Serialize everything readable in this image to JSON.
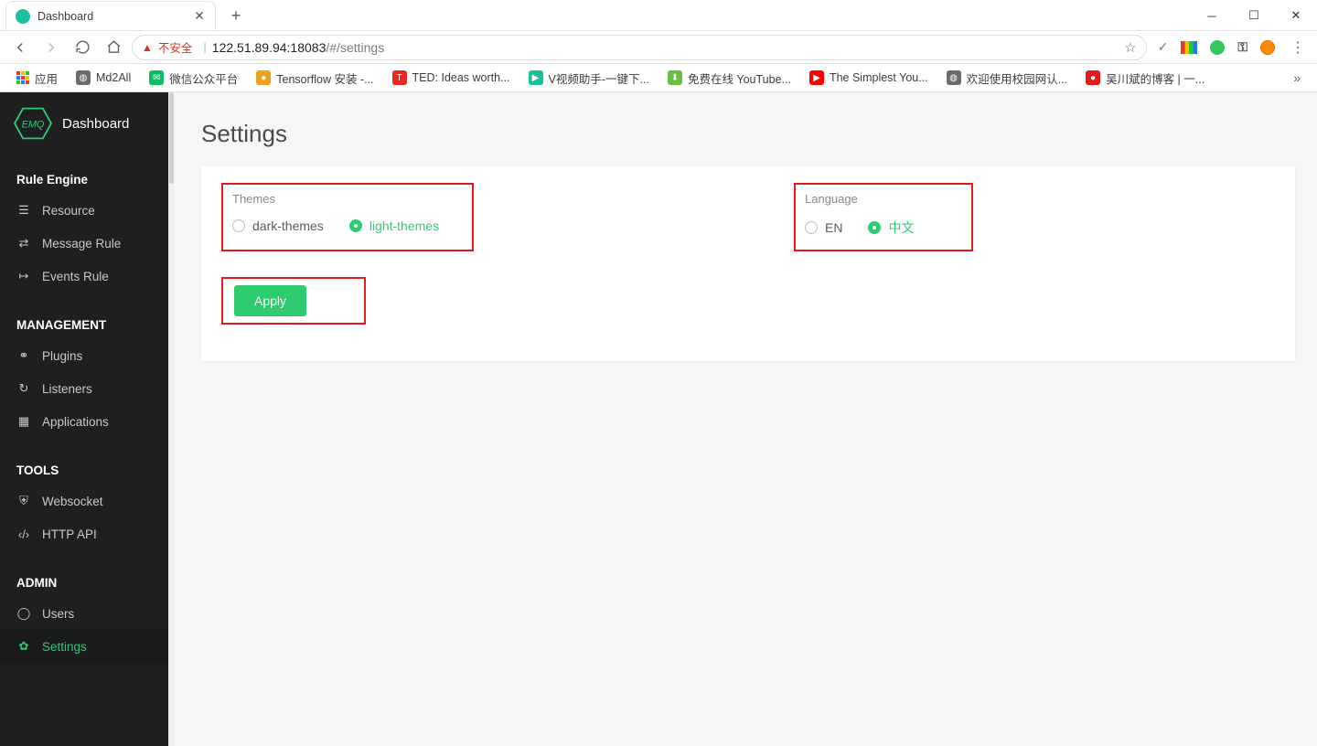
{
  "browser": {
    "tab_title": "Dashboard",
    "insecure_label": "不安全",
    "url_host": "122.51.89.94:18083",
    "url_path": "/#/settings",
    "apps_label": "应用",
    "bookmarks": [
      {
        "label": "Md2All",
        "bg": "#6b6b6b"
      },
      {
        "label": "微信公众平台",
        "bg": "#07c160"
      },
      {
        "label": "Tensorflow 安装 -...",
        "bg": "#f0a020"
      },
      {
        "label": "TED: Ideas worth...",
        "bg": "#e62b1e",
        "letter": "T"
      },
      {
        "label": "V视频助手-一键下...",
        "bg": "#1cbf9e"
      },
      {
        "label": "免费在线 YouTube...",
        "bg": "#6abf40"
      },
      {
        "label": "The Simplest You...",
        "bg": "#ff0000"
      },
      {
        "label": "欢迎使用校园网认...",
        "bg": "#6b6b6b"
      },
      {
        "label": "吴川斌的博客 | 一...",
        "bg": "#e21a1a"
      }
    ]
  },
  "sidebar": {
    "brand_text": "EMQ",
    "brand_label": "Dashboard",
    "sections": [
      {
        "header": "Rule Engine",
        "items": [
          {
            "label": "Resource",
            "icon": "list"
          },
          {
            "label": "Message Rule",
            "icon": "shuffle"
          },
          {
            "label": "Events Rule",
            "icon": "arrow-right"
          }
        ]
      },
      {
        "header": "MANAGEMENT",
        "items": [
          {
            "label": "Plugins",
            "icon": "plug"
          },
          {
            "label": "Listeners",
            "icon": "refresh"
          },
          {
            "label": "Applications",
            "icon": "grid"
          }
        ]
      },
      {
        "header": "TOOLS",
        "items": [
          {
            "label": "Websocket",
            "icon": "shield"
          },
          {
            "label": "HTTP API",
            "icon": "code"
          }
        ]
      },
      {
        "header": "ADMIN",
        "items": [
          {
            "label": "Users",
            "icon": "user"
          },
          {
            "label": "Settings",
            "icon": "gear",
            "active": true
          }
        ]
      }
    ]
  },
  "page": {
    "title": "Settings",
    "themes": {
      "label": "Themes",
      "options": [
        "dark-themes",
        "light-themes"
      ],
      "selected": "light-themes"
    },
    "language": {
      "label": "Language",
      "options": [
        "EN",
        "中文"
      ],
      "selected": "中文"
    },
    "apply_label": "Apply"
  }
}
